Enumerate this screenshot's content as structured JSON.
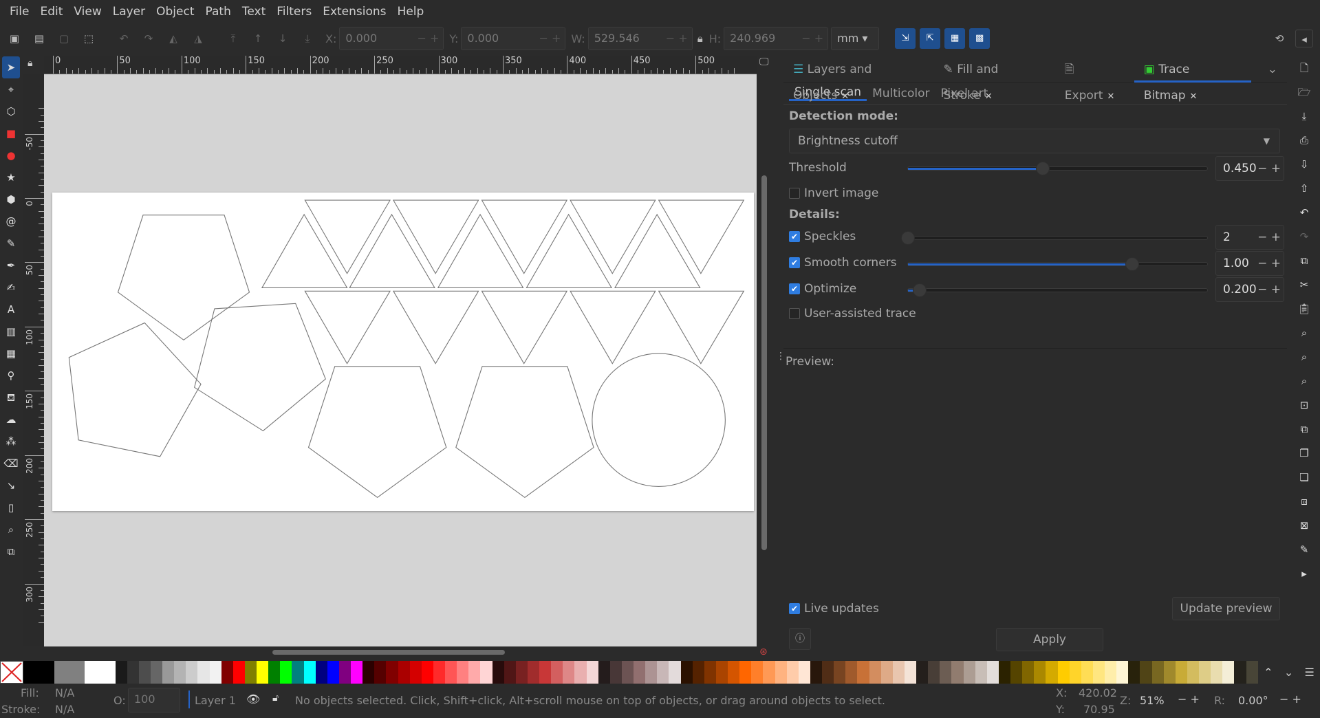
{
  "menu": [
    "File",
    "Edit",
    "View",
    "Layer",
    "Object",
    "Path",
    "Text",
    "Filters",
    "Extensions",
    "Help"
  ],
  "toolbar": {
    "x_label": "X:",
    "x": "0.000",
    "y_label": "Y:",
    "y": "0.000",
    "w_label": "W:",
    "w": "529.546",
    "h_label": "H:",
    "h": "240.969",
    "unit": "mm"
  },
  "ruler": {
    "h_ticks": [
      "0",
      "50",
      "100",
      "150",
      "200",
      "250",
      "300",
      "350",
      "400",
      "450",
      "500"
    ],
    "v_ticks": [
      "-50",
      "0",
      "50",
      "100",
      "150",
      "200",
      "250",
      "300"
    ]
  },
  "tools": [
    "selector",
    "node",
    "shape-builder",
    "rectangle",
    "ellipse",
    "star",
    "3d-box",
    "spiral",
    "pencil",
    "pen",
    "calligraphy",
    "text",
    "gradient",
    "mesh",
    "dropper",
    "paint-bucket",
    "tweak",
    "spray",
    "eraser",
    "connector",
    "pages",
    "zoom",
    "measure"
  ],
  "panel": {
    "tabs": [
      {
        "label": "Layers and Objects",
        "icon": "layers-icon"
      },
      {
        "label": "Fill and Stroke",
        "icon": "fill-stroke-icon"
      },
      {
        "label": "Export",
        "icon": "export-icon"
      },
      {
        "label": "Trace Bitmap",
        "icon": "trace-bitmap-icon",
        "active": true
      }
    ],
    "subtabs": [
      "Single scan",
      "Multicolor",
      "Pixel art"
    ],
    "detection_label": "Detection mode:",
    "detection_value": "Brightness cutoff",
    "threshold": {
      "label": "Threshold",
      "value": "0.450",
      "fraction": 0.45
    },
    "invert": {
      "label": "Invert image",
      "checked": false
    },
    "details_label": "Details:",
    "speckles": {
      "label": "Speckles",
      "checked": true,
      "value": "2",
      "fraction": 0.0
    },
    "smooth": {
      "label": "Smooth corners",
      "checked": true,
      "value": "1.00",
      "fraction": 0.75
    },
    "optimize": {
      "label": "Optimize",
      "checked": true,
      "value": "0.200",
      "fraction": 0.04
    },
    "user_assisted": {
      "label": "User-assisted trace",
      "checked": false
    },
    "preview_label": "Preview:",
    "live_updates": {
      "label": "Live updates",
      "checked": true
    },
    "update_preview": "Update preview",
    "apply": "Apply"
  },
  "palette": [
    "#000000",
    "#808080",
    "#ffffff",
    "#1a1a1a",
    "#333333",
    "#4d4d4d",
    "#666666",
    "#999999",
    "#b3b3b3",
    "#cccccc",
    "#e6e6e6",
    "#f2f2f2",
    "#800000",
    "#ff0000",
    "#808000",
    "#ffff00",
    "#008000",
    "#00ff00",
    "#008080",
    "#00ffff",
    "#000080",
    "#0000ff",
    "#800080",
    "#ff00ff",
    "#2b0000",
    "#550000",
    "#800000",
    "#aa0000",
    "#d40000",
    "#ff0000",
    "#ff2a2a",
    "#ff5555",
    "#ff8080",
    "#ffaaaa",
    "#ffd5d5",
    "#280b0b",
    "#501616",
    "#782121",
    "#a02c2c",
    "#c83737",
    "#d35f5f",
    "#de8787",
    "#e9afaf",
    "#f4d7d7",
    "#241c1c",
    "#483737",
    "#6c5353",
    "#916f6f",
    "#ac9393",
    "#c8b7b7",
    "#e3dbdb",
    "#2b1100",
    "#552200",
    "#803300",
    "#aa4400",
    "#d45500",
    "#ff6600",
    "#ff7f2a",
    "#ff9955",
    "#ffb380",
    "#ffccaa",
    "#ffe6d5",
    "#28170b",
    "#502d16",
    "#784421",
    "#a05a2c",
    "#c87137",
    "#d38d5f",
    "#deaa87",
    "#e9c6af",
    "#f4e3d7",
    "#241f1c",
    "#483e37",
    "#6c5d53",
    "#917c6f",
    "#ac9d93",
    "#c8beb7",
    "#e3dedb",
    "#2b2200",
    "#554400",
    "#806600",
    "#aa8800",
    "#d4aa00",
    "#ffcc00",
    "#ffd42a",
    "#ffdd55",
    "#ffe680",
    "#ffeeaa",
    "#fff6d5",
    "#28220b",
    "#504416",
    "#786721",
    "#a0892c",
    "#c8ab37",
    "#d3bc5f",
    "#decd87",
    "#e9ddaf",
    "#f4eed7",
    "#24221c",
    "#484537"
  ],
  "status": {
    "fill_label": "Fill:",
    "fill": "N/A",
    "stroke_label": "Stroke:",
    "stroke": "N/A",
    "opacity_label": "O:",
    "opacity": "100",
    "layer": "Layer 1",
    "message": "No objects selected. Click, Shift+click, Alt+scroll mouse on top of objects, or drag around objects to select.",
    "x_label": "X:",
    "x": "420.02",
    "y_label": "Y:",
    "y": "70.95",
    "zoom_label": "Z:",
    "zoom": "51%",
    "rot_label": "R:",
    "rotation": "0.00°"
  }
}
